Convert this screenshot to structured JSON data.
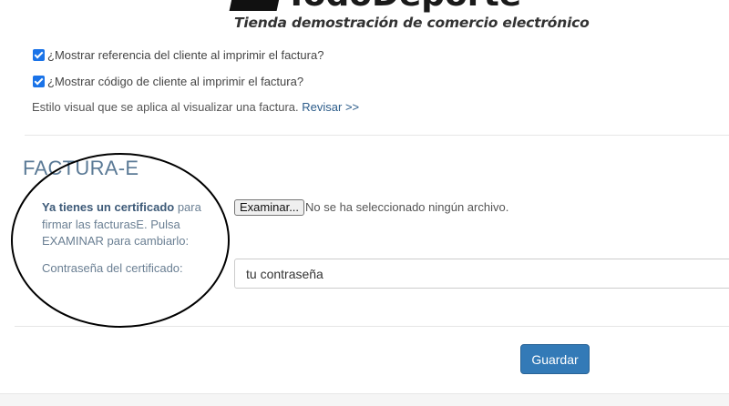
{
  "logo": {
    "brand": "TodoDeporte",
    "tagline": "Tienda demostración de comercio electrónico"
  },
  "options": {
    "show_customer_ref": {
      "label": "¿Mostrar referencia del cliente al imprimir el factura?",
      "checked": true
    },
    "show_customer_code": {
      "label": "¿Mostrar código de cliente al imprimir el factura?",
      "checked": true
    },
    "visual_style": {
      "text": "Estilo visual que se aplica al visualizar una factura.",
      "link": "Revisar >>"
    }
  },
  "einvoice": {
    "title": "FACTURA-E",
    "certificate_bold": "Ya tienes un certificado",
    "certificate_rest": " para firmar las facturasE. Pulsa EXAMINAR para cambiarlo:",
    "browse_button": "Examinar...",
    "file_status": "No se ha seleccionado ningún archivo.",
    "password_label": "Contraseña del certificado:",
    "password_placeholder": "tu contraseña"
  },
  "actions": {
    "save": "Guardar"
  },
  "colors": {
    "accent": "#337ab7",
    "checkbox": "#1a73e8",
    "section_title": "#5b7a96",
    "link": "#2c5c8a"
  }
}
